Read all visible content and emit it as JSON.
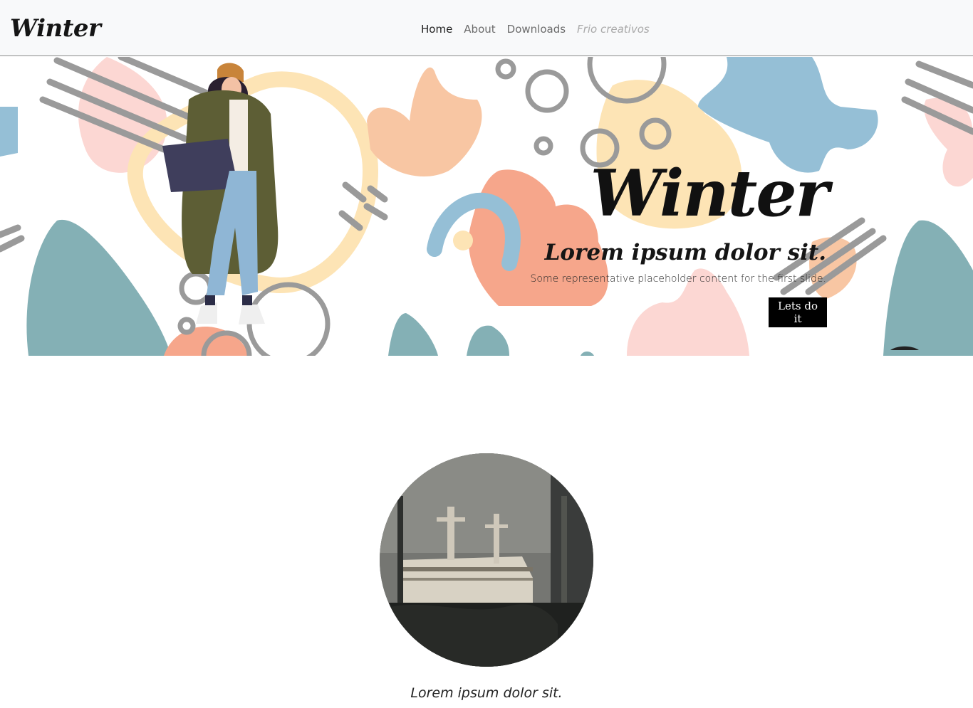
{
  "navbar": {
    "brand": "Winter",
    "links": [
      {
        "label": "Home",
        "state": "active"
      },
      {
        "label": "About",
        "state": "normal"
      },
      {
        "label": "Downloads",
        "state": "normal"
      },
      {
        "label": "Frio creativos",
        "state": "disabled"
      }
    ]
  },
  "hero": {
    "title": "Winter",
    "subtitle": "Lorem ipsum dolor sit.",
    "text": "Some representative placeholder content for the first slide.",
    "button_label": "Lets do it"
  },
  "card": {
    "caption": "Lorem ipsum dolor sit."
  },
  "colors": {
    "pink": "#fcd7d3",
    "peach": "#f8c6a3",
    "coral": "#f6a68b",
    "blue": "#95bfd6",
    "teal": "#84b0b5",
    "yellow": "#fde4b5",
    "grey": "#9a9a9a"
  }
}
